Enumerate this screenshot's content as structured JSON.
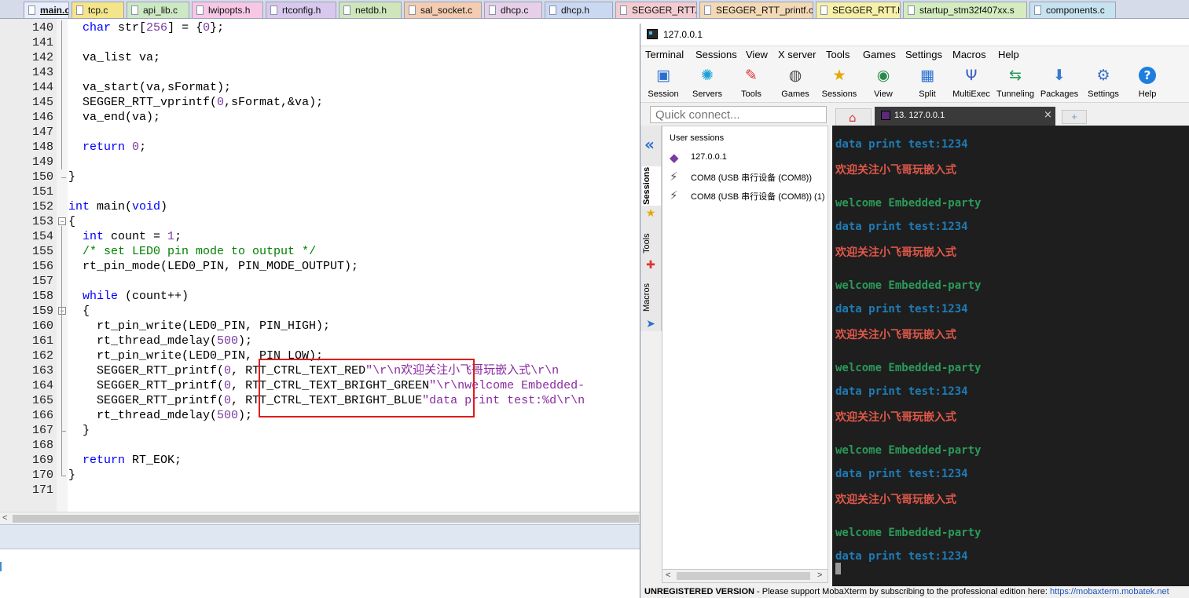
{
  "file_tabs": [
    {
      "label": "main.c",
      "active": true,
      "color": "#e8eefc"
    },
    {
      "label": "tcp.c",
      "active": false,
      "color": "#f4e58b"
    },
    {
      "label": "api_lib.c",
      "active": false,
      "color": "#cde8c4"
    },
    {
      "label": "lwipopts.h",
      "active": false,
      "color": "#f6c8e5"
    },
    {
      "label": "rtconfig.h",
      "active": false,
      "color": "#d8c8ee"
    },
    {
      "label": "netdb.h",
      "active": false,
      "color": "#cfe6bd"
    },
    {
      "label": "sal_socket.c",
      "active": false,
      "color": "#f3ccb1"
    },
    {
      "label": "dhcp.c",
      "active": false,
      "color": "#e6cfe8"
    },
    {
      "label": "dhcp.h",
      "active": false,
      "color": "#cad8f2"
    },
    {
      "label": "SEGGER_RTT.c",
      "active": false,
      "color": "#f2ccd0"
    },
    {
      "label": "SEGGER_RTT_printf.c",
      "active": false,
      "color": "#f3d9b6"
    },
    {
      "label": "SEGGER_RTT.h",
      "active": false,
      "color": "#f7f0a8"
    },
    {
      "label": "startup_stm32f407xx.s",
      "active": false,
      "color": "#d4ecc0"
    },
    {
      "label": "components.c",
      "active": false,
      "color": "#c7e3ef"
    }
  ],
  "editor": {
    "lines": [
      {
        "n": "140",
        "tokens": [
          {
            "t": "  "
          },
          {
            "t": "char",
            "c": "kw"
          },
          {
            "t": " str["
          },
          {
            "t": "256",
            "c": "num"
          },
          {
            "t": "] = {"
          },
          {
            "t": "0",
            "c": "num"
          },
          {
            "t": "};"
          }
        ]
      },
      {
        "n": "141",
        "tokens": []
      },
      {
        "n": "142",
        "tokens": [
          {
            "t": "  va_list va;"
          }
        ]
      },
      {
        "n": "143",
        "tokens": []
      },
      {
        "n": "144",
        "tokens": [
          {
            "t": "  va_start(va,sFormat);"
          }
        ]
      },
      {
        "n": "145",
        "tokens": [
          {
            "t": "  SEGGER_RTT_vprintf("
          },
          {
            "t": "0",
            "c": "num"
          },
          {
            "t": ",sFormat,&va);"
          }
        ]
      },
      {
        "n": "146",
        "tokens": [
          {
            "t": "  va_end(va);"
          }
        ]
      },
      {
        "n": "147",
        "tokens": []
      },
      {
        "n": "148",
        "tokens": [
          {
            "t": "  "
          },
          {
            "t": "return",
            "c": "kw"
          },
          {
            "t": " "
          },
          {
            "t": "0",
            "c": "num"
          },
          {
            "t": ";"
          }
        ]
      },
      {
        "n": "149",
        "tokens": []
      },
      {
        "n": "150",
        "tokens": [
          {
            "t": "}"
          }
        ]
      },
      {
        "n": "151",
        "tokens": []
      },
      {
        "n": "152",
        "tokens": [
          {
            "t": "int",
            "c": "kw"
          },
          {
            "t": " main("
          },
          {
            "t": "void",
            "c": "kw"
          },
          {
            "t": ")"
          }
        ]
      },
      {
        "n": "153",
        "tokens": [
          {
            "t": "{"
          }
        ]
      },
      {
        "n": "154",
        "tokens": [
          {
            "t": "  "
          },
          {
            "t": "int",
            "c": "kw"
          },
          {
            "t": " count = "
          },
          {
            "t": "1",
            "c": "num"
          },
          {
            "t": ";"
          }
        ]
      },
      {
        "n": "155",
        "tokens": [
          {
            "t": "  "
          },
          {
            "t": "/* set LED0 pin mode to output */",
            "c": "cm"
          }
        ]
      },
      {
        "n": "156",
        "tokens": [
          {
            "t": "  rt_pin_mode(LED0_PIN, PIN_MODE_OUTPUT);"
          }
        ]
      },
      {
        "n": "157",
        "tokens": []
      },
      {
        "n": "158",
        "tokens": [
          {
            "t": "  "
          },
          {
            "t": "while",
            "c": "kw"
          },
          {
            "t": " (count++)"
          }
        ]
      },
      {
        "n": "159",
        "tokens": [
          {
            "t": "  {"
          }
        ]
      },
      {
        "n": "160",
        "tokens": [
          {
            "t": "    rt_pin_write(LED0_PIN, PIN_HIGH);"
          }
        ]
      },
      {
        "n": "161",
        "tokens": [
          {
            "t": "    rt_thread_mdelay("
          },
          {
            "t": "500",
            "c": "num"
          },
          {
            "t": ");"
          }
        ]
      },
      {
        "n": "162",
        "tokens": [
          {
            "t": "    rt_pin_write(LED0_PIN, PIN_LOW);"
          }
        ]
      },
      {
        "n": "163",
        "tokens": [
          {
            "t": "    SEGGER_RTT_printf("
          },
          {
            "t": "0",
            "c": "num"
          },
          {
            "t": ", RTT_CTRL_TEXT_RED"
          },
          {
            "t": "\"\\r\\n欢迎关注小飞哥玩嵌入式\\r\\n",
            "c": "str"
          }
        ]
      },
      {
        "n": "164",
        "tokens": [
          {
            "t": "    SEGGER_RTT_printf("
          },
          {
            "t": "0",
            "c": "num"
          },
          {
            "t": ", RTT_CTRL_TEXT_BRIGHT_GREEN"
          },
          {
            "t": "\"\\r\\nwelcome Embedded-",
            "c": "str"
          }
        ]
      },
      {
        "n": "165",
        "tokens": [
          {
            "t": "    SEGGER_RTT_printf("
          },
          {
            "t": "0",
            "c": "num"
          },
          {
            "t": ", RTT_CTRL_TEXT_BRIGHT_BLUE"
          },
          {
            "t": "\"data print test:%d\\r\\n",
            "c": "str"
          }
        ]
      },
      {
        "n": "166",
        "tokens": [
          {
            "t": "    rt_thread_mdelay("
          },
          {
            "t": "500",
            "c": "num"
          },
          {
            "t": ");"
          }
        ]
      },
      {
        "n": "167",
        "tokens": [
          {
            "t": "  }"
          }
        ]
      },
      {
        "n": "168",
        "tokens": []
      },
      {
        "n": "169",
        "tokens": [
          {
            "t": "  "
          },
          {
            "t": "return",
            "c": "kw"
          },
          {
            "t": " RT_EOK;"
          }
        ]
      },
      {
        "n": "170",
        "tokens": [
          {
            "t": "}"
          }
        ]
      },
      {
        "n": "171",
        "tokens": []
      }
    ],
    "fold_markers": [
      {
        "line": "153",
        "symbol": "−"
      },
      {
        "line": "159",
        "symbol": "−"
      }
    ]
  },
  "mobaxterm": {
    "title": "127.0.0.1",
    "menu": [
      "Terminal",
      "Sessions",
      "View",
      "X server",
      "Tools",
      "Games",
      "Settings",
      "Macros",
      "Help"
    ],
    "toolbar": [
      {
        "label": "Session",
        "icon": "monitor-icon"
      },
      {
        "label": "Servers",
        "icon": "servers-icon"
      },
      {
        "label": "Tools",
        "icon": "tools-icon"
      },
      {
        "label": "Games",
        "icon": "gamepad-icon"
      },
      {
        "label": "Sessions",
        "icon": "star-icon"
      },
      {
        "label": "View",
        "icon": "view-icon"
      },
      {
        "label": "Split",
        "icon": "split-icon"
      },
      {
        "label": "MultiExec",
        "icon": "fork-icon"
      },
      {
        "label": "Tunneling",
        "icon": "tunnel-icon"
      },
      {
        "label": "Packages",
        "icon": "package-icon"
      },
      {
        "label": "Settings",
        "icon": "gears-icon"
      },
      {
        "label": "Help",
        "icon": "help-icon"
      }
    ],
    "quick_connect_placeholder": "Quick connect...",
    "side_tabs": [
      "Sessions",
      "Tools",
      "Macros"
    ],
    "user_sessions_header": "User sessions",
    "sessions": [
      {
        "label": "127.0.0.1",
        "icon": "ssh-session-icon"
      },
      {
        "label": "COM8  (USB 串行设备 (COM8))",
        "icon": "serial-plug-icon"
      },
      {
        "label": "COM8  (USB 串行设备 (COM8)) (1)",
        "icon": "serial-plug-icon"
      }
    ],
    "terminal_tab": {
      "label": "13. 127.0.0.1",
      "close": "×"
    },
    "terminal_lines": [
      {
        "text": "data print test:1234",
        "color": "blue"
      },
      {
        "text": "欢迎关注小飞哥玩嵌入式",
        "color": "red"
      },
      {
        "text": "",
        "color": "blue"
      },
      {
        "text": "welcome Embedded-party",
        "color": "green"
      },
      {
        "text": "data print test:1234",
        "color": "blue"
      },
      {
        "text": "欢迎关注小飞哥玩嵌入式",
        "color": "red"
      },
      {
        "text": "",
        "color": "blue"
      },
      {
        "text": "welcome Embedded-party",
        "color": "green"
      },
      {
        "text": "data print test:1234",
        "color": "blue"
      },
      {
        "text": "欢迎关注小飞哥玩嵌入式",
        "color": "red"
      },
      {
        "text": "",
        "color": "blue"
      },
      {
        "text": "welcome Embedded-party",
        "color": "green"
      },
      {
        "text": "data print test:1234",
        "color": "blue"
      },
      {
        "text": "欢迎关注小飞哥玩嵌入式",
        "color": "red"
      },
      {
        "text": "",
        "color": "blue"
      },
      {
        "text": "welcome Embedded-party",
        "color": "green"
      },
      {
        "text": "data print test:1234",
        "color": "blue"
      },
      {
        "text": "欢迎关注小飞哥玩嵌入式",
        "color": "red"
      },
      {
        "text": "",
        "color": "blue"
      },
      {
        "text": "welcome Embedded-party",
        "color": "green"
      },
      {
        "text": "data print test:1234",
        "color": "blue"
      }
    ],
    "status": {
      "unregistered": "UNREGISTERED VERSION",
      "message": "  -  Please support MobaXterm by subscribing to the professional edition here:  ",
      "link": "https://mobaxterm.mobatek.net"
    },
    "colors": {
      "term_blue": "#1e7cb7",
      "term_red": "#e0584a",
      "term_green": "#2b9a59",
      "term_bg": "#1e1e1e",
      "highlight_box": "#e01b1b"
    }
  }
}
